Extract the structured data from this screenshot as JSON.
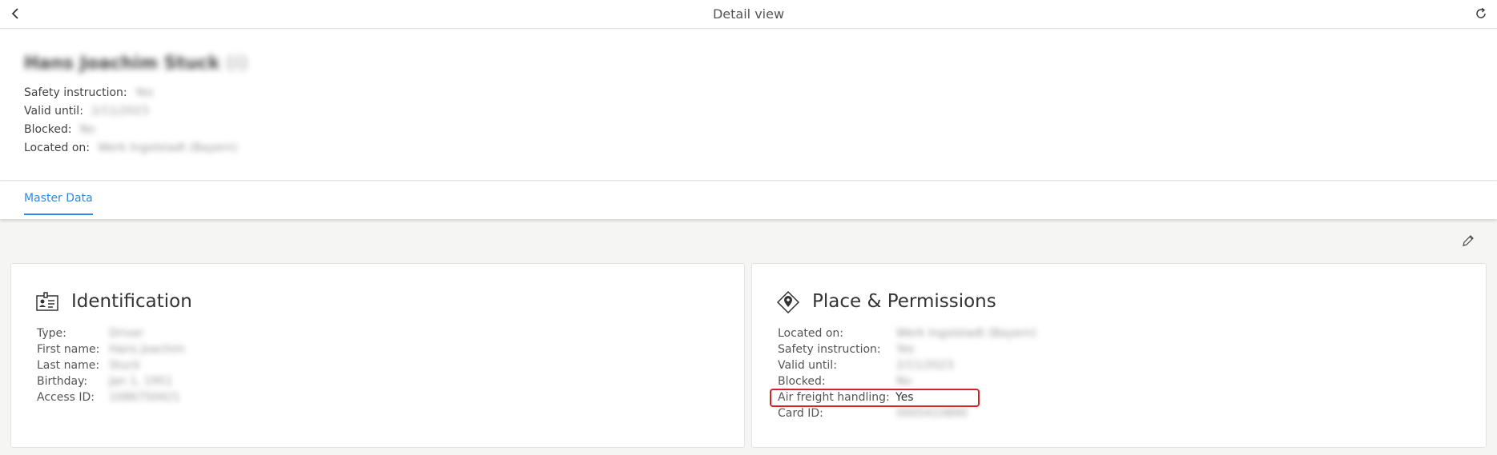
{
  "topbar": {
    "title": "Detail view",
    "back_icon": "chevron-left-icon",
    "refresh_icon": "refresh-icon"
  },
  "header": {
    "name": "Hans Joachim Stuck",
    "name_tail": "(i)",
    "fields": [
      {
        "label": "Safety instruction:",
        "value": "Yes"
      },
      {
        "label": "Valid until:",
        "value": "2/11/2023"
      },
      {
        "label": "Blocked:",
        "value": "No"
      },
      {
        "label": "Located on:",
        "value": "Werk Ingolstadt (Bayern)"
      }
    ]
  },
  "tabs": [
    {
      "label": "Master Data",
      "active": true
    }
  ],
  "toolbar": {
    "edit_icon": "pencil-icon"
  },
  "identification": {
    "title": "Identification",
    "icon": "id-card-icon",
    "fields": [
      {
        "label": "Type:",
        "value": "Driver"
      },
      {
        "label": "First name:",
        "value": "Hans Joachim"
      },
      {
        "label": "Last name:",
        "value": "Stuck"
      },
      {
        "label": "Birthday:",
        "value": "Jan 1, 1951"
      },
      {
        "label": "Access ID:",
        "value": "1086750421"
      }
    ]
  },
  "permissions": {
    "title": "Place & Permissions",
    "icon": "location-pin-icon",
    "fields": [
      {
        "label": "Located on:",
        "value": "Werk Ingolstadt (Bayern)"
      },
      {
        "label": "Safety instruction:",
        "value": "Yes"
      },
      {
        "label": "Valid until:",
        "value": "2/11/2023"
      },
      {
        "label": "Blocked:",
        "value": "No"
      },
      {
        "label": "Air freight handling:",
        "value": "Yes"
      },
      {
        "label": "Card ID:",
        "value": "0005410890"
      }
    ]
  },
  "colors": {
    "accent": "#2b8ae8",
    "highlight": "#d9221f"
  }
}
